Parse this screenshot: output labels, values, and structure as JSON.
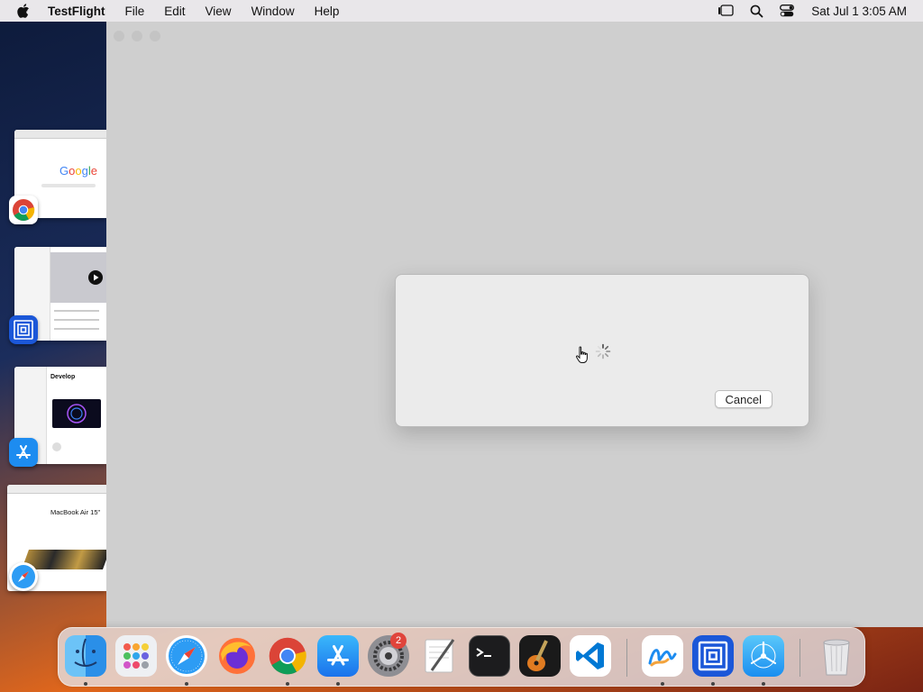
{
  "menubar": {
    "app_name": "TestFlight",
    "menus": [
      "File",
      "Edit",
      "View",
      "Window",
      "Help"
    ],
    "clock": "Sat Jul 1  3:05 AM",
    "status_icons": [
      "stage-manager-icon",
      "spotlight-icon",
      "control-center-icon"
    ]
  },
  "stage_manager": {
    "thumbnails": [
      {
        "app": "Google Chrome",
        "icon": "chrome-icon",
        "page_text": "Google"
      },
      {
        "app": "Simulator",
        "icon": "simulator-icon",
        "page_text": ""
      },
      {
        "app": "App Store",
        "icon": "app-store-icon",
        "page_text": "Develop"
      },
      {
        "app": "Safari",
        "icon": "safari-icon",
        "page_text": "MacBook Air 15\""
      }
    ]
  },
  "dialog": {
    "cancel_label": "Cancel",
    "state": "loading"
  },
  "dock": {
    "apps": [
      {
        "name": "Finder",
        "icon": "finder-icon",
        "running": true
      },
      {
        "name": "Launchpad",
        "icon": "launchpad-icon",
        "running": false
      },
      {
        "name": "Safari",
        "icon": "safari-icon",
        "running": true
      },
      {
        "name": "Firefox",
        "icon": "firefox-icon",
        "running": false
      },
      {
        "name": "Google Chrome",
        "icon": "chrome-icon",
        "running": true
      },
      {
        "name": "App Store",
        "icon": "app-store-icon",
        "running": true
      },
      {
        "name": "System Settings",
        "icon": "settings-icon",
        "running": false,
        "badge": "2"
      },
      {
        "name": "TextEdit",
        "icon": "textedit-icon",
        "running": false
      },
      {
        "name": "Terminal",
        "icon": "terminal-icon",
        "running": false
      },
      {
        "name": "GarageBand",
        "icon": "garageband-icon",
        "running": false
      },
      {
        "name": "Visual Studio Code",
        "icon": "vscode-icon",
        "running": false
      },
      {
        "name": "Freeform",
        "icon": "freeform-icon",
        "running": true
      },
      {
        "name": "Simulator",
        "icon": "simulator-icon",
        "running": true
      },
      {
        "name": "TestFlight",
        "icon": "testflight-icon",
        "running": true
      },
      {
        "name": "Trash",
        "icon": "trash-icon",
        "running": false
      }
    ]
  },
  "colors": {
    "menubar_bg": "#e9e7ea",
    "window_bg": "#cfcfcf",
    "sheet_bg": "#ebebeb",
    "badge_red": "#e0443b"
  }
}
